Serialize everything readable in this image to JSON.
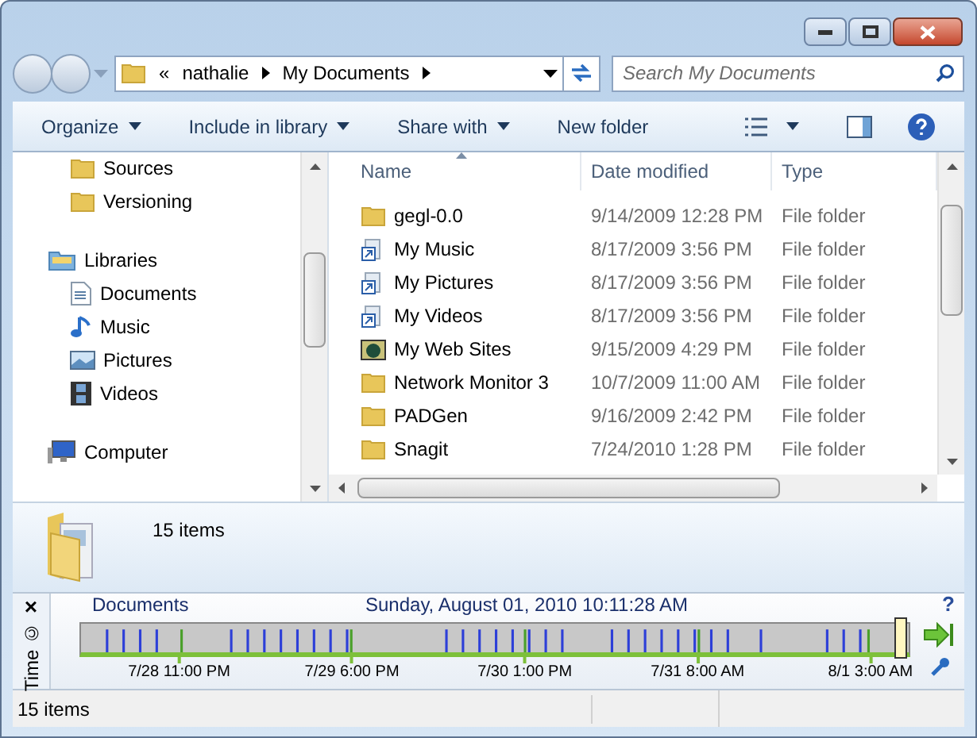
{
  "address_bar": {
    "segments": [
      "«",
      "nathalie",
      "My Documents"
    ]
  },
  "search": {
    "placeholder": "Search My Documents"
  },
  "toolbar": {
    "items": [
      {
        "label": "Organize",
        "dropdown": true
      },
      {
        "label": "Include in library",
        "dropdown": true
      },
      {
        "label": "Share with",
        "dropdown": true
      },
      {
        "label": "New folder",
        "dropdown": false
      }
    ]
  },
  "nav_pane": {
    "items": [
      {
        "label": "Sources",
        "kind": "folder"
      },
      {
        "label": "Versioning",
        "kind": "folder"
      },
      {
        "label": "Libraries",
        "kind": "library",
        "children": [
          {
            "label": "Documents",
            "kind": "documents"
          },
          {
            "label": "Music",
            "kind": "music"
          },
          {
            "label": "Pictures",
            "kind": "pictures"
          },
          {
            "label": "Videos",
            "kind": "videos"
          }
        ]
      },
      {
        "label": "Computer",
        "kind": "computer"
      }
    ]
  },
  "table": {
    "columns": [
      {
        "label": "Name",
        "sorted": true
      },
      {
        "label": "Date modified",
        "sorted": false
      },
      {
        "label": "Type",
        "sorted": false
      }
    ],
    "rows": [
      {
        "kind": "folder",
        "name": "gegl-0.0",
        "date": "9/14/2009 12:28 PM",
        "type": "File folder"
      },
      {
        "kind": "shortcut",
        "name": "My Music",
        "date": "8/17/2009 3:56 PM",
        "type": "File folder"
      },
      {
        "kind": "shortcut",
        "name": "My Pictures",
        "date": "8/17/2009 3:56 PM",
        "type": "File folder"
      },
      {
        "kind": "shortcut",
        "name": "My Videos",
        "date": "8/17/2009 3:56 PM",
        "type": "File folder"
      },
      {
        "kind": "web",
        "name": "My Web Sites",
        "date": "9/15/2009 4:29 PM",
        "type": "File folder"
      },
      {
        "kind": "folder",
        "name": "Network Monitor 3",
        "date": "10/7/2009 11:00 AM",
        "type": "File folder"
      },
      {
        "kind": "folder",
        "name": "PADGen",
        "date": "9/16/2009 2:42 PM",
        "type": "File folder"
      },
      {
        "kind": "folder",
        "name": "Snagit",
        "date": "7/24/2010 1:28 PM",
        "type": "File folder"
      }
    ]
  },
  "details_pane": {
    "count": "15 items"
  },
  "time_panel": {
    "close": "×",
    "title": "Time ©",
    "location": "Documents",
    "datetime": "Sunday, August 01, 2010 10:11:28 AM",
    "help": "?",
    "level": 0.99,
    "ticks": [
      "7/28 11:00 PM",
      "7/29 6:00 PM",
      "7/30 1:00 PM",
      "7/31 8:00 AM",
      "8/1 3:00 AM"
    ]
  },
  "status_bar": {
    "text": "15 items"
  }
}
